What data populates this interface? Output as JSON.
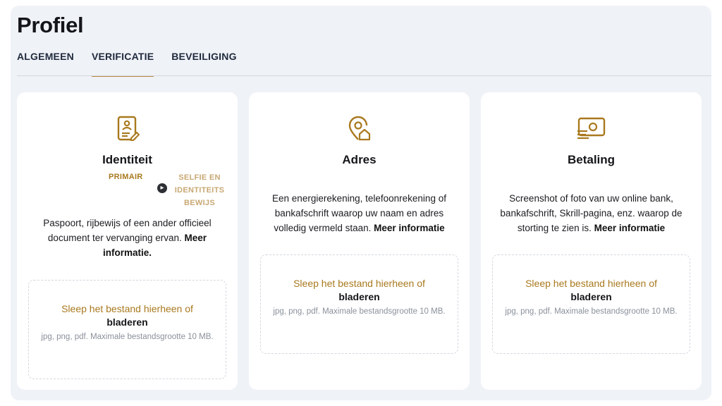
{
  "page": {
    "title": "Profiel"
  },
  "tabs": [
    {
      "label": "ALGEMEEN",
      "active": false
    },
    {
      "label": "VERIFICATIE",
      "active": true
    },
    {
      "label": "BEVEILIGING",
      "active": false
    }
  ],
  "colors": {
    "accent": "#b88a3e",
    "accent_text": "#a9791f",
    "panel_bg": "#eff2f7",
    "card_bg": "#ffffff"
  },
  "cards": [
    {
      "icon": "id-document-icon",
      "title": "Identiteit",
      "badge": "PRIMAIR",
      "alt_link": "SELFIE EN IDENTITEITS BEWIJS",
      "description": "Paspoort, rijbewijs of een ander officieel document ter vervanging ervan.",
      "more_info": "Meer informatie.",
      "dropzone": {
        "line1": "Sleep het bestand hierheen of",
        "browse": "bladeren",
        "hint": "jpg, png, pdf. Maximale bestandsgrootte 10 MB."
      }
    },
    {
      "icon": "location-home-icon",
      "title": "Adres",
      "description": "Een energierekening, telefoonrekening of bankafschrift waarop uw naam en adres volledig vermeld staan.",
      "more_info": "Meer informatie",
      "dropzone": {
        "line1": "Sleep het bestand hierheen of",
        "browse": "bladeren",
        "hint": "jpg, png, pdf. Maximale bestandsgrootte 10 MB."
      }
    },
    {
      "icon": "payment-card-icon",
      "title": "Betaling",
      "description": "Screenshot of foto van uw online bank, bankafschrift, Skrill-pagina, enz. waarop de storting te zien is.",
      "more_info": "Meer informatie",
      "dropzone": {
        "line1": "Sleep het bestand hierheen of",
        "browse": "bladeren",
        "hint": "jpg, png, pdf. Maximale bestandsgrootte 10 MB."
      }
    }
  ]
}
